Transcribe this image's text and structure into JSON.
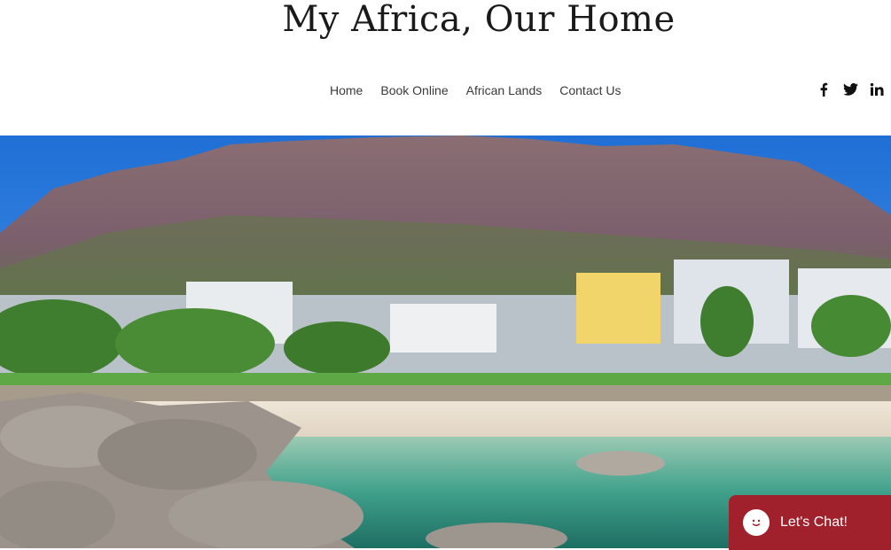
{
  "site": {
    "title": "My Africa, Our Home"
  },
  "nav": {
    "items": [
      {
        "label": "Home"
      },
      {
        "label": "Book Online"
      },
      {
        "label": "African Lands"
      },
      {
        "label": "Contact Us"
      }
    ]
  },
  "social": {
    "icons": [
      "facebook-icon",
      "twitter-icon",
      "linkedin-icon"
    ]
  },
  "chat": {
    "label": "Let's Chat!",
    "color": "#a0212c"
  },
  "colors": {
    "text": "#1a1a1a",
    "nav_text": "#3a3a3a",
    "chat_bg": "#a0212c"
  }
}
